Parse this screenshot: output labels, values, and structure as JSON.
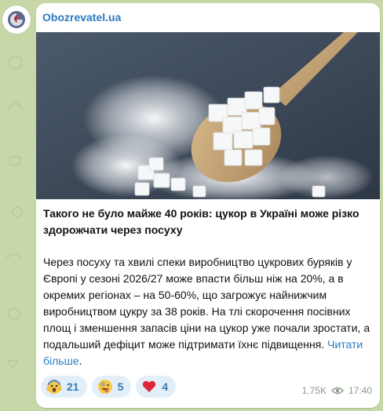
{
  "channel": {
    "name": "Obozrevatel.ua"
  },
  "post": {
    "headline": "Такого не було майже 40 років: цукор в Україні може різко здорожчати через посуху",
    "body": "Через посуху та хвилі спеки виробництво цукрових буряків у Європі у сезоні 2026/27 може впасти більш ніж на 20%, а в окремих регіонах – на 50-60%, що загрожує найнижчим виробництвом цукру за 38 років. На тлі скорочення посівних площ і зменшення запасів ціни на цукор уже почали зростати, а подальший дефіцит може підтримати їхнє підвищення.",
    "read_more": "Читати більше",
    "read_more_suffix": "."
  },
  "reactions": [
    {
      "icon": "screaming-face-icon",
      "count": "21"
    },
    {
      "icon": "zany-face-icon",
      "count": "5"
    },
    {
      "icon": "red-heart-icon",
      "count": "4"
    }
  ],
  "meta": {
    "views": "1.75K",
    "time": "17:40"
  },
  "colors": {
    "link": "#2a7bc0",
    "background": "#c8d7a8",
    "reaction_bg": "#e3eff8"
  }
}
